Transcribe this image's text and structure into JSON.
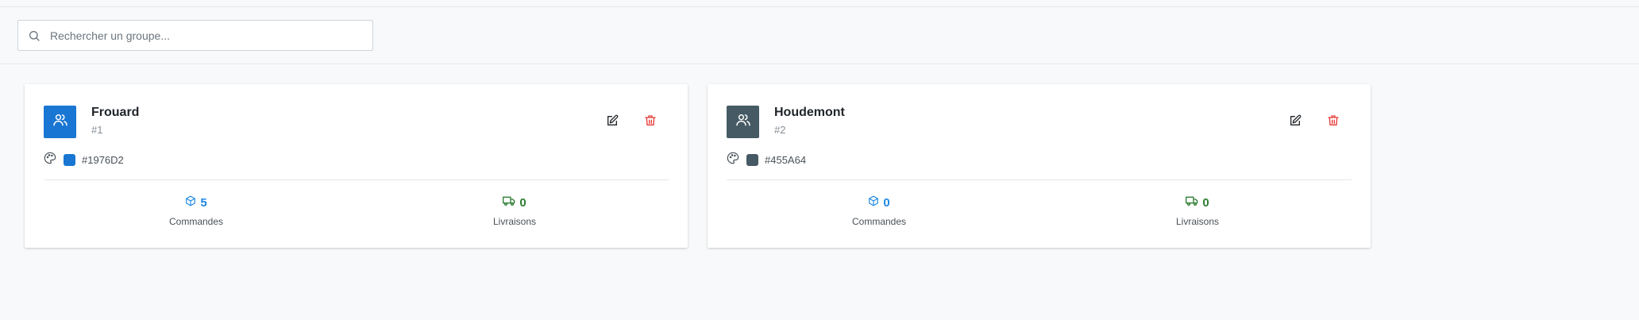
{
  "search": {
    "placeholder": "Rechercher un groupe..."
  },
  "colors": {
    "orders": "#1e88e5",
    "deliveries": "#2e7d32",
    "delete": "#e53935"
  },
  "groups": [
    {
      "name": "Frouard",
      "id_label": "#1",
      "color_hex": "#1976D2",
      "orders_count": "5",
      "orders_label": "Commandes",
      "deliveries_count": "0",
      "deliveries_label": "Livraisons"
    },
    {
      "name": "Houdemont",
      "id_label": "#2",
      "color_hex": "#455A64",
      "orders_count": "0",
      "orders_label": "Commandes",
      "deliveries_count": "0",
      "deliveries_label": "Livraisons"
    }
  ]
}
